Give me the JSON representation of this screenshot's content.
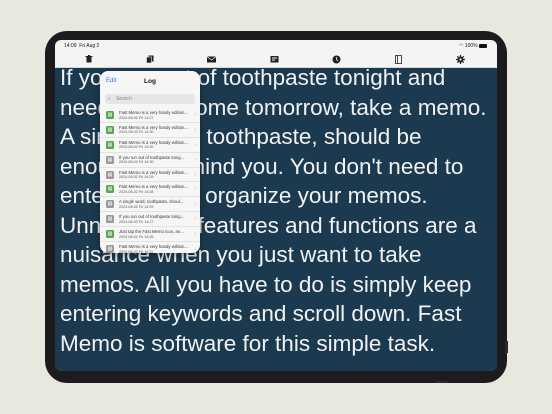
{
  "status": {
    "time": "14:09",
    "date": "Fri Aug 2",
    "battery": "100%"
  },
  "toolbar": {
    "icons": [
      "trash-icon",
      "copy-icon",
      "mail-icon",
      "action-icon",
      "clock-icon",
      "book-icon",
      "gear-icon"
    ]
  },
  "memo": {
    "text": "If you run out of toothpaste tonight and need to buy some tomorrow, take a memo. A single word, toothpaste, should be enough to remind you. You don't need to enter dates or organize your memos. Unnecessary features and functions are a nuisance when you just want to take memos. All you have to do is simply keep entering keywords and scroll down. Fast Memo is software for this simple task."
  },
  "popover": {
    "edit_label": "Edit",
    "title": "Log",
    "search_placeholder": "Search",
    "items": [
      {
        "icon": "green",
        "text": "Fast Memo is a very handy edition...",
        "date": "2024-08-02 Fri 14:27"
      },
      {
        "icon": "green",
        "text": "Fast Memo is a very handy edition...",
        "date": "2024-08-02 Fri 14:30"
      },
      {
        "icon": "green",
        "text": "Fast Memo is a very handy edition...",
        "date": "2024-08-02 Fri 14:30"
      },
      {
        "icon": "gray",
        "text": "If you run out of toothpaste tonig...",
        "date": "2024-08-02 Fri 14:30"
      },
      {
        "icon": "gray",
        "text": "Fast Memo is a very handy edition...",
        "date": "2024-08-02 Fri 14:29"
      },
      {
        "icon": "green",
        "text": "Fast Memo is a very handy edition...",
        "date": "2024-08-02 Fri 14:28"
      },
      {
        "icon": "gray",
        "text": "A single word, toothpaste, shoul...",
        "date": "2024-08-02 Fri 14:29"
      },
      {
        "icon": "gray",
        "text": "If you run out of toothpaste tonig...",
        "date": "2024-08-02 Fri 14:27"
      },
      {
        "icon": "green",
        "text": "Just tap the Fast Memo icon, an...",
        "date": "2024-08-02 Fri 14:26"
      },
      {
        "icon": "gray",
        "text": "Fast Memo is a very handy edition...",
        "date": "2024-08-02 Fri 14:22"
      }
    ]
  },
  "colors": {
    "accent": "#2b7de0",
    "screen_bg": "#1c3a4f",
    "green_icon": "#5aa652",
    "gray_icon": "#9a9a9a"
  }
}
